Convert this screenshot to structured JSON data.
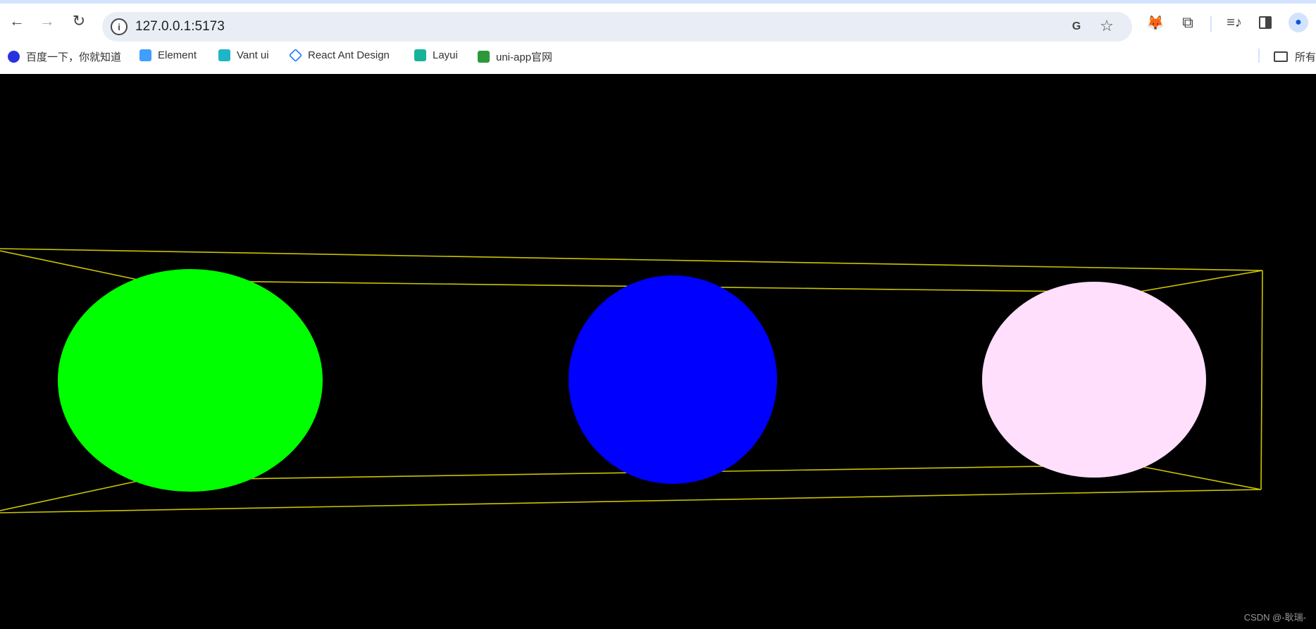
{
  "browser": {
    "url": "127.0.0.1:5173",
    "bookmarks": [
      {
        "label": "百度一下，你就知道",
        "icon": "baidu-icon",
        "color": "#2932e1"
      },
      {
        "label": "Element",
        "icon": "element-icon",
        "color": "#409eff"
      },
      {
        "label": "Vant ui",
        "icon": "vant-icon",
        "color": "#1fb5c9"
      },
      {
        "label": "React Ant Design",
        "icon": "antd-icon",
        "color": "#1677ff"
      },
      {
        "label": "Layui",
        "icon": "layui-icon",
        "color": "#16b39a"
      },
      {
        "label": "uni-app官网",
        "icon": "uniapp-icon",
        "color": "#2b9939"
      }
    ],
    "all_bookmarks_label": "所有"
  },
  "scene": {
    "background": "#000000",
    "box_color": "#c8c400",
    "spheres": [
      {
        "name": "green",
        "color": "#00ff00"
      },
      {
        "name": "blue",
        "color": "#0000ff"
      },
      {
        "name": "pink",
        "color": "#ffdffc"
      }
    ]
  },
  "watermark": "CSDN @-耿瑞-"
}
